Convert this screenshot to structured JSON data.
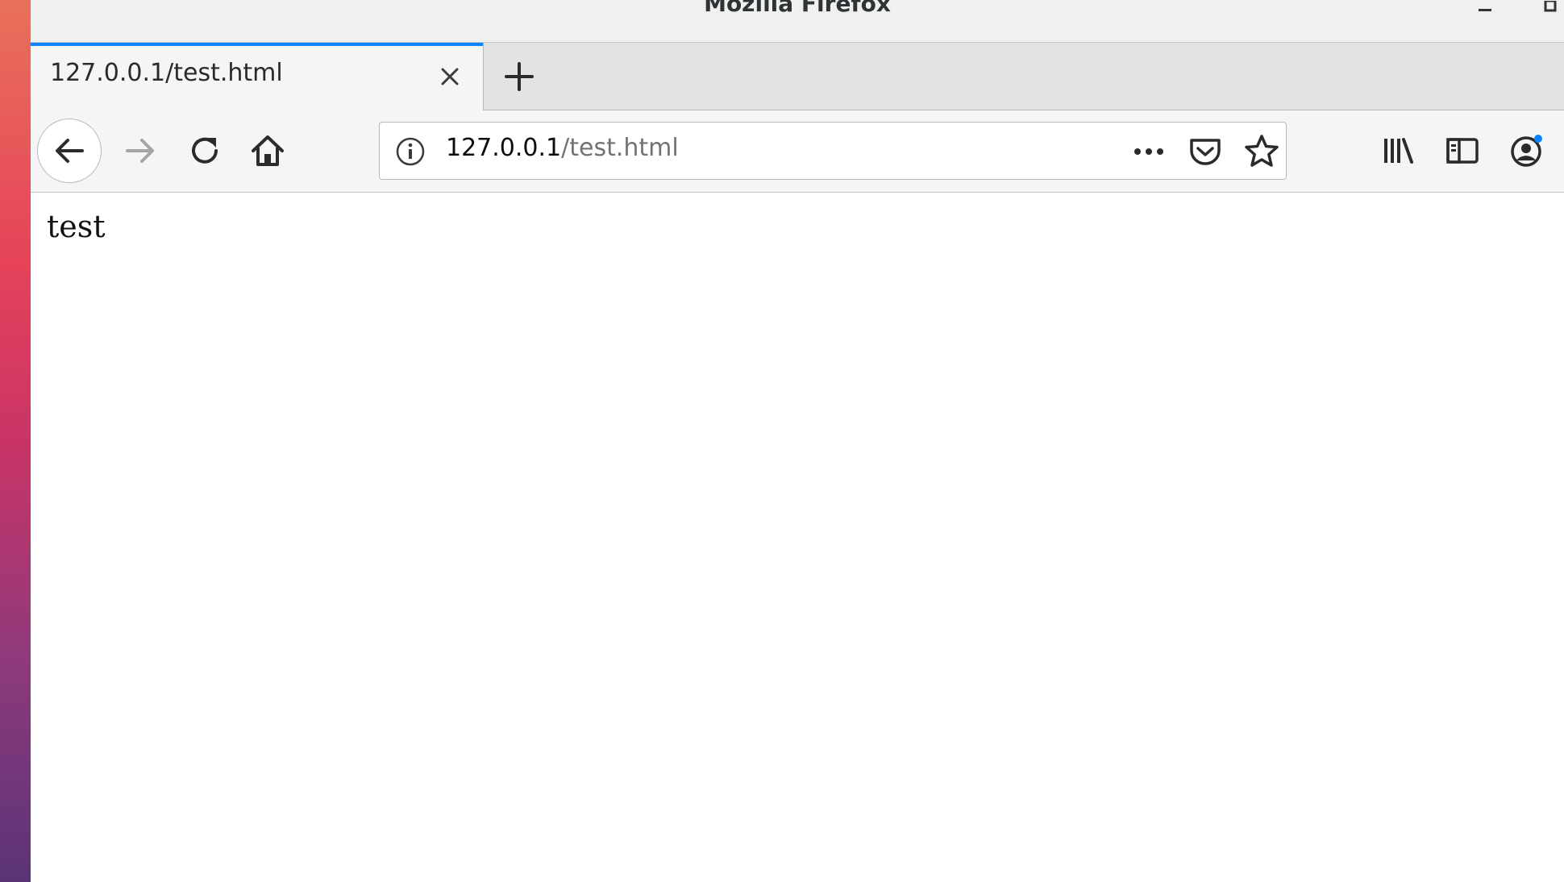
{
  "window": {
    "title": "Mozilla Firefox"
  },
  "tabs": [
    {
      "label": "127.0.0.1/test.html",
      "active": true
    }
  ],
  "urlbar": {
    "host": "127.0.0.1",
    "path": "/test.html"
  },
  "page": {
    "body_text": "test"
  },
  "colors": {
    "tab_accent": "#0a84ff",
    "notification_dot": "#0a84ff"
  },
  "icons": {
    "back": "back-arrow-icon",
    "forward": "forward-arrow-icon",
    "reload": "reload-icon",
    "home": "home-icon",
    "info": "info-icon",
    "page_actions": "more-horizontal-icon",
    "pocket": "pocket-icon",
    "bookmark": "star-icon",
    "library": "library-icon",
    "sidebar": "sidebar-icon",
    "account": "account-icon"
  }
}
